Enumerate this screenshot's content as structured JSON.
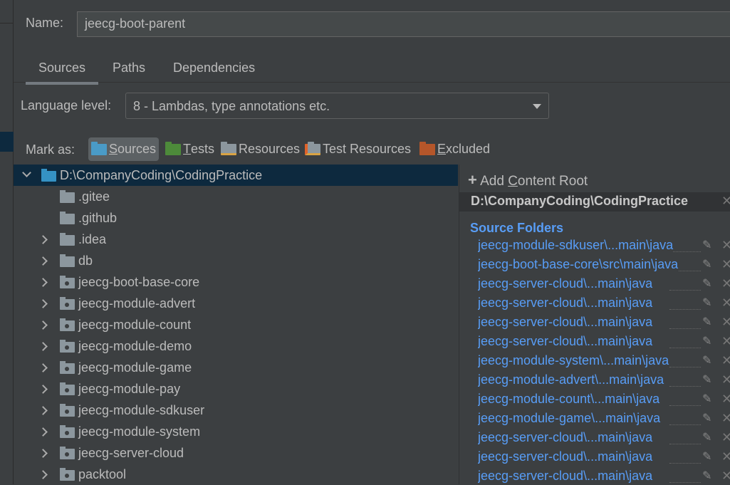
{
  "name_field": {
    "label": "Name:",
    "value": "jeecg-boot-parent"
  },
  "tabs": [
    {
      "label": "Sources",
      "active": true
    },
    {
      "label": "Paths"
    },
    {
      "label": "Dependencies"
    }
  ],
  "language_level": {
    "label": "Language level:",
    "value": "8 - Lambdas, type annotations etc."
  },
  "mark_as": {
    "label": "Mark as:",
    "items": [
      {
        "label": "Sources",
        "mnemonic": "S",
        "rest": "ources",
        "color": "#4a9bc7",
        "active": true
      },
      {
        "label": "Tests",
        "mnemonic": "T",
        "rest": "ests",
        "color": "#4d8a3a"
      },
      {
        "label": "Resources",
        "mnemonic": "",
        "rest": "Resources",
        "color": "#8c979e"
      },
      {
        "label": "Test Resources",
        "mnemonic": "",
        "rest": "Test Resources",
        "color": "#8c979e"
      },
      {
        "label": "Excluded",
        "mnemonic": "E",
        "rest": "xcluded",
        "color": "#b5562a"
      }
    ]
  },
  "tree": {
    "root": "D:\\CompanyCoding\\CodingPractice",
    "children": [
      {
        "label": ".gitee",
        "expandable": false,
        "module": false
      },
      {
        "label": ".github",
        "expandable": false,
        "module": false
      },
      {
        "label": ".idea",
        "expandable": true,
        "module": false
      },
      {
        "label": "db",
        "expandable": true,
        "module": false
      },
      {
        "label": "jeecg-boot-base-core",
        "expandable": true,
        "module": true
      },
      {
        "label": "jeecg-module-advert",
        "expandable": true,
        "module": true
      },
      {
        "label": "jeecg-module-count",
        "expandable": true,
        "module": true
      },
      {
        "label": "jeecg-module-demo",
        "expandable": true,
        "module": true
      },
      {
        "label": "jeecg-module-game",
        "expandable": true,
        "module": true
      },
      {
        "label": "jeecg-module-pay",
        "expandable": true,
        "module": true
      },
      {
        "label": "jeecg-module-sdkuser",
        "expandable": true,
        "module": true
      },
      {
        "label": "jeecg-module-system",
        "expandable": true,
        "module": true
      },
      {
        "label": "jeecg-server-cloud",
        "expandable": true,
        "module": true
      },
      {
        "label": "packtool",
        "expandable": true,
        "module": true
      }
    ]
  },
  "content_root": {
    "add_label": "Add Content Root",
    "add_mnemonic": "C",
    "path": "D:\\CompanyCoding\\CodingPractice",
    "source_folders_title": "Source Folders",
    "source_folders": [
      "jeecg-module-sdkuser\\...main\\java",
      "jeecg-boot-base-core\\src\\main\\java",
      "jeecg-server-cloud\\...main\\java",
      "jeecg-server-cloud\\...main\\java",
      "jeecg-server-cloud\\...main\\java",
      "jeecg-server-cloud\\...main\\java",
      "jeecg-module-system\\...main\\java",
      "jeecg-module-advert\\...main\\java",
      "jeecg-module-count\\...main\\java",
      "jeecg-module-game\\...main\\java",
      "jeecg-server-cloud\\...main\\java",
      "jeecg-server-cloud\\...main\\java",
      "jeecg-server-cloud\\...main\\java"
    ]
  },
  "colors": {
    "background": "#3c3f41",
    "selection": "#0d293e",
    "link": "#589df6"
  }
}
